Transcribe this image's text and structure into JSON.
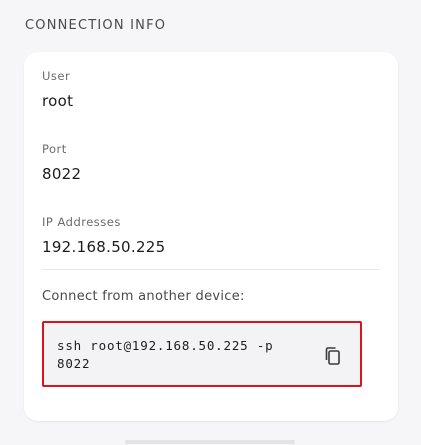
{
  "section": {
    "title": "CONNECTION INFO"
  },
  "fields": {
    "user": {
      "label": "User",
      "value": "root"
    },
    "port": {
      "label": "Port",
      "value": "8022"
    },
    "ip": {
      "label": "IP Addresses",
      "value": "192.168.50.225"
    }
  },
  "connect": {
    "label": "Connect from another device:",
    "command": "ssh root@192.168.50.225 -p 8022",
    "copy_icon": "copy-icon"
  },
  "colors": {
    "highlight": "#d8141c",
    "card": "#ffffff",
    "background": "#f6f5f7"
  }
}
